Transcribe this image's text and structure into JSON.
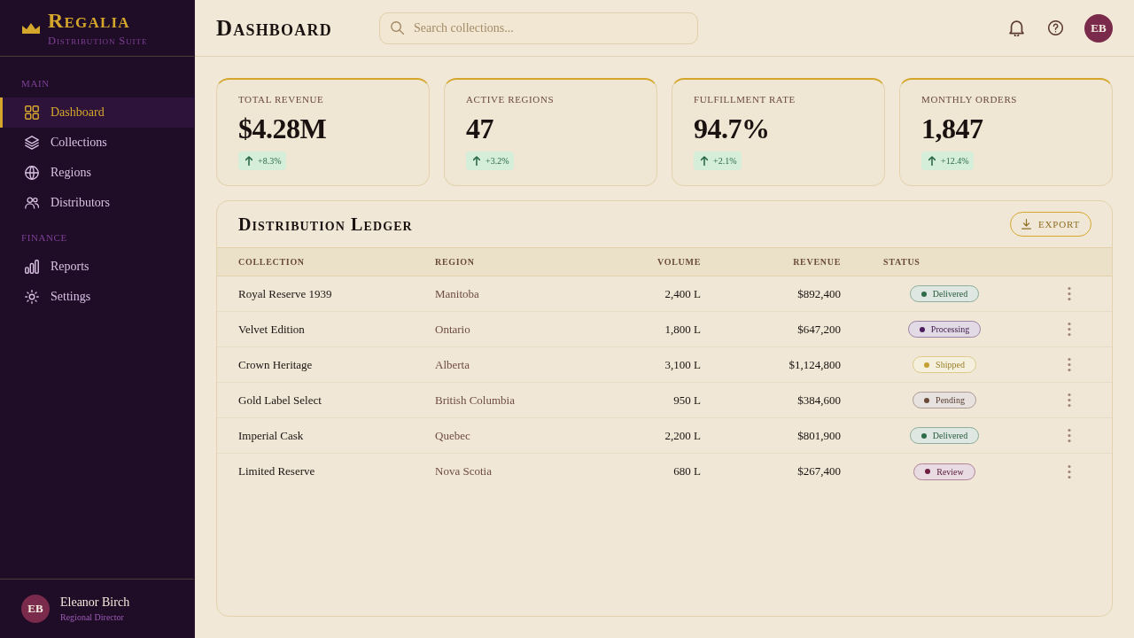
{
  "sidebar": {
    "brand": {
      "name": "Regalia",
      "tagline": "Distribution Suite"
    },
    "sections": [
      {
        "label": "MAIN",
        "items": [
          {
            "label": "Dashboard",
            "selected": true
          },
          {
            "label": "Collections",
            "selected": false
          },
          {
            "label": "Regions",
            "selected": false
          },
          {
            "label": "Distributors",
            "selected": false
          }
        ]
      },
      {
        "label": "FINANCE",
        "items": [
          {
            "label": "Reports",
            "selected": false
          },
          {
            "label": "Settings",
            "selected": false
          }
        ]
      }
    ],
    "user": {
      "initials": "EB",
      "name": "Eleanor Birch",
      "role": "Regional Director"
    }
  },
  "header": {
    "title": "Dashboard",
    "search": {
      "placeholder": "Search collections..."
    },
    "avatar": {
      "initials": "EB"
    }
  },
  "stats": [
    {
      "label": "TOTAL REVENUE",
      "value": "$4.28M",
      "change": "+8.3%"
    },
    {
      "label": "ACTIVE REGIONS",
      "value": "47",
      "change": "+3.2%"
    },
    {
      "label": "FULFILLMENT RATE",
      "value": "94.7%",
      "change": "+2.1%"
    },
    {
      "label": "MONTHLY ORDERS",
      "value": "1,847",
      "change": "+12.4%"
    }
  ],
  "ledger": {
    "title": "Distribution Ledger",
    "export_button": "EXPORT",
    "columns": [
      "COLLECTION",
      "REGION",
      "VOLUME",
      "REVENUE",
      "STATUS"
    ],
    "rows": [
      {
        "collection": "Royal Reserve 1939",
        "region": "Manitoba",
        "volume": "2,400 L",
        "revenue": "$892,400",
        "status": {
          "label": "Delivered",
          "color": "#2f6b48"
        }
      },
      {
        "collection": "Velvet Edition",
        "region": "Ontario",
        "volume": "1,800 L",
        "revenue": "$647,200",
        "status": {
          "label": "Processing",
          "color": "#4b1d5c"
        }
      },
      {
        "collection": "Crown Heritage",
        "region": "Alberta",
        "volume": "3,100 L",
        "revenue": "$1,124,800",
        "status": {
          "label": "Shipped",
          "color": "#c2a032"
        }
      },
      {
        "collection": "Gold Label Select",
        "region": "British Columbia",
        "volume": "950 L",
        "revenue": "$384,600",
        "status": {
          "label": "Pending",
          "color": "#6b4a3a"
        }
      },
      {
        "collection": "Imperial Cask",
        "region": "Quebec",
        "volume": "2,200 L",
        "revenue": "$801,900",
        "status": {
          "label": "Delivered",
          "color": "#2f6b48"
        }
      },
      {
        "collection": "Limited Reserve",
        "region": "Nova Scotia",
        "volume": "680 L",
        "revenue": "$267,400",
        "status": {
          "label": "Review",
          "color": "#6e1f42"
        }
      }
    ]
  }
}
